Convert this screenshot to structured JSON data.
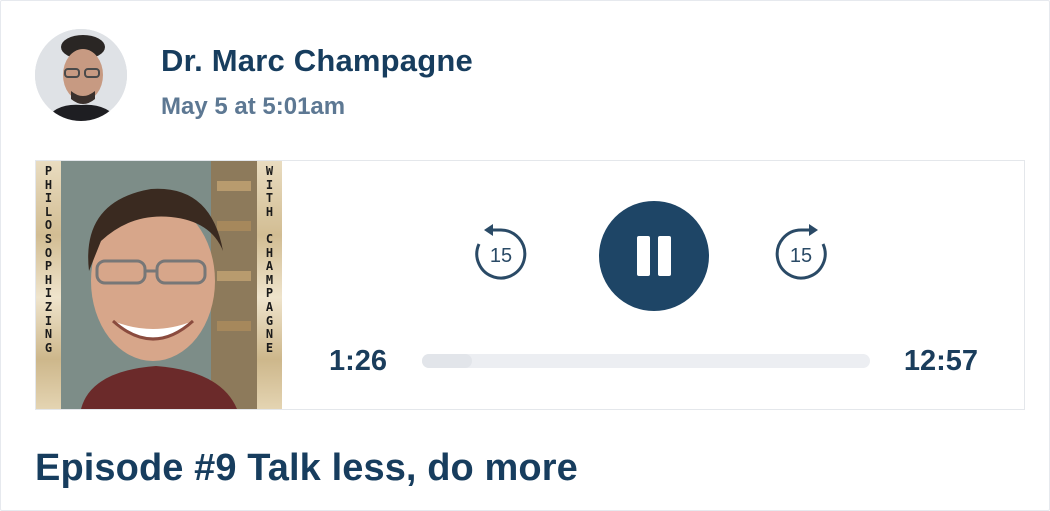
{
  "post": {
    "author_name": "Dr. Marc Champagne",
    "date": "May 5 at 5:01am"
  },
  "cover": {
    "left_text": [
      "P",
      "H",
      "I",
      "L",
      "O",
      "S",
      "O",
      "P",
      "H",
      "I",
      "Z",
      "I",
      "N",
      "G"
    ],
    "right_text": [
      "W",
      "I",
      "T",
      "H",
      "",
      "C",
      "H",
      "A",
      "M",
      "P",
      "A",
      "G",
      "N",
      "E"
    ]
  },
  "player": {
    "skip_back_label": "15",
    "skip_forward_label": "15",
    "elapsed": "1:26",
    "duration": "12:57",
    "progress_fraction": 0.111,
    "state": "playing"
  },
  "episode": {
    "title": "Episode #9 Talk less, do more"
  },
  "icons": [
    "avatar-photo",
    "pause-icon",
    "rewind-15-icon",
    "forward-15-icon"
  ],
  "colors": {
    "primary": "#1e4566",
    "text_dark": "#173d5e",
    "text_muted": "#5d7893",
    "track": "#eceef2"
  }
}
